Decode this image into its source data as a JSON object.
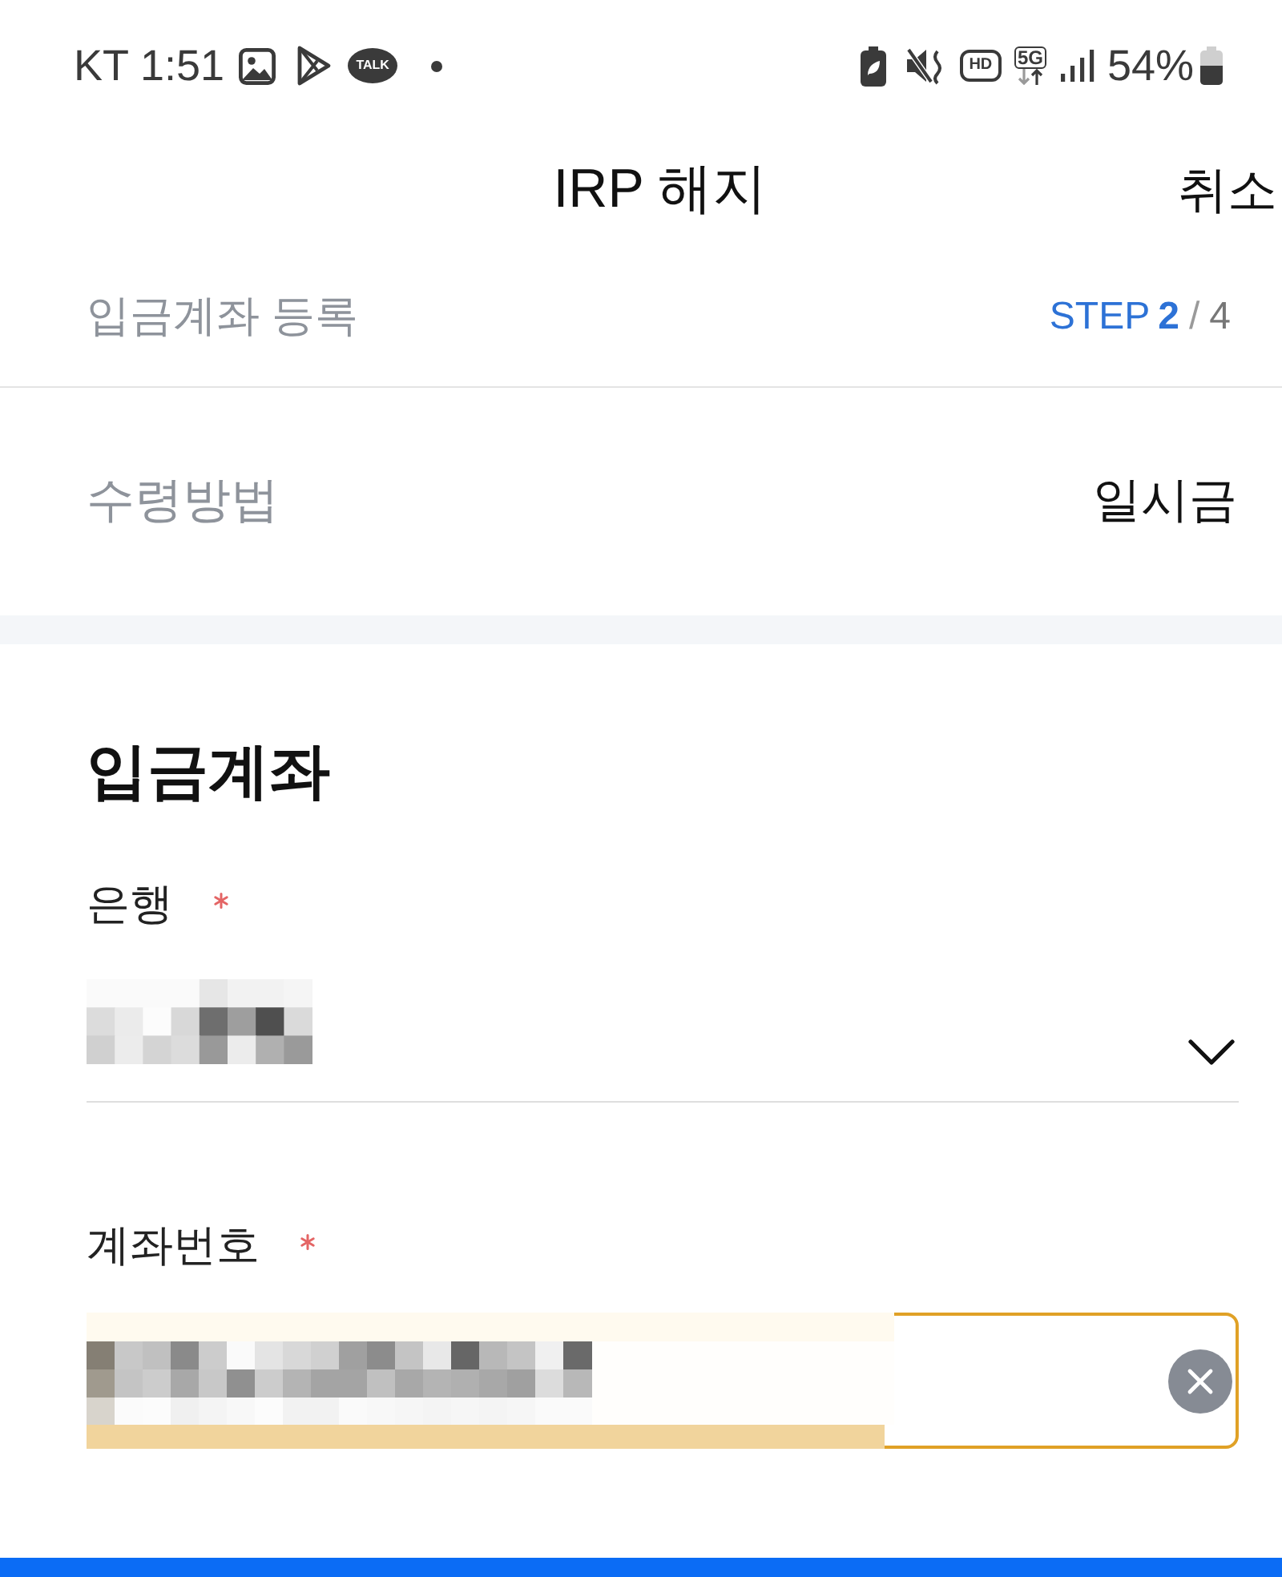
{
  "status_bar": {
    "carrier_time": "KT 1:51",
    "chat_badge": "TALK",
    "call_badge": "HD",
    "network": "5G",
    "battery": "54%"
  },
  "header": {
    "title": "IRP 해지",
    "cancel": "취소"
  },
  "step": {
    "label": "입금계좌 등록",
    "prefix": "STEP",
    "current": "2",
    "separator": "/",
    "total": "4"
  },
  "receipt_method": {
    "label": "수령방법",
    "value": "일시금"
  },
  "deposit_account": {
    "title": "입금계좌",
    "fields": [
      {
        "kind": "select",
        "label": "은행",
        "required": true,
        "focused": false
      },
      {
        "kind": "text",
        "label": "계좌번호",
        "required": true,
        "focused": true
      }
    ]
  }
}
